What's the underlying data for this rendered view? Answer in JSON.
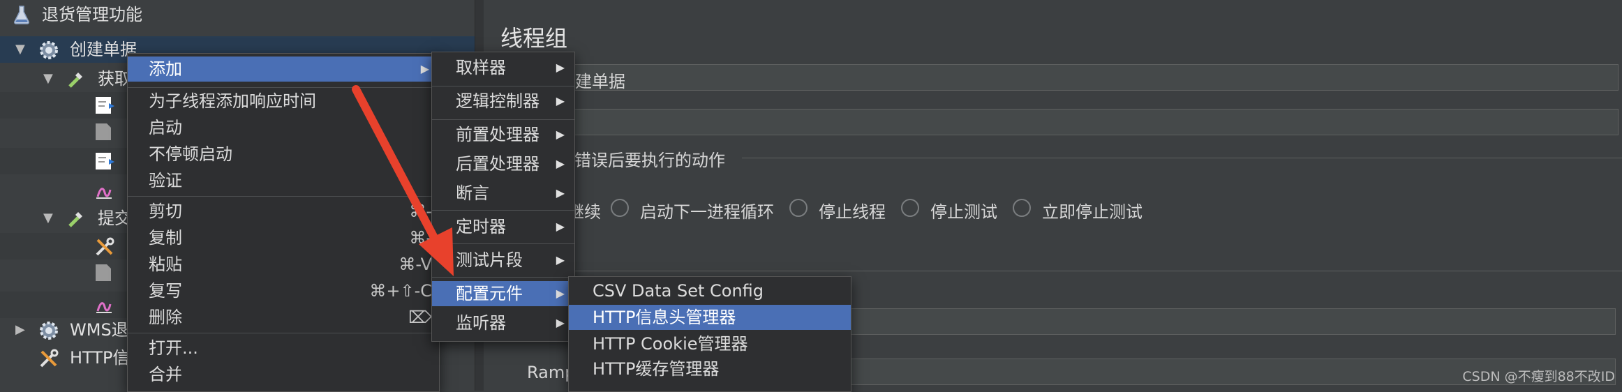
{
  "tree": {
    "root_label": "退货管理功能",
    "items": [
      {
        "label": "创建单据"
      },
      {
        "label": "获取"
      },
      {
        "label": "提交"
      },
      {
        "label": "WMS退"
      },
      {
        "label": "HTTP信"
      }
    ]
  },
  "panel": {
    "title": "线程组",
    "name_value": "创建单据",
    "error_action_label": "错误后要执行的动作",
    "radio_options": [
      "继续",
      "启动下一进程循环",
      "停止线程",
      "停止测试",
      "立即停止测试"
    ],
    "ramp_label": "Ramp"
  },
  "context_menu": {
    "items": [
      {
        "label": "添加",
        "shortcut": "",
        "submenu": true
      },
      {
        "label": "为子线程添加响应时间",
        "shortcut": ""
      },
      {
        "label": "启动",
        "shortcut": ""
      },
      {
        "label": "不停顿启动",
        "shortcut": ""
      },
      {
        "label": "验证",
        "shortcut": ""
      },
      {
        "label": "剪切",
        "shortcut": "⌘-"
      },
      {
        "label": "复制",
        "shortcut": "⌘-"
      },
      {
        "label": "粘贴",
        "shortcut": "⌘-V"
      },
      {
        "label": "复写",
        "shortcut": "⌘+⇧-C"
      },
      {
        "label": "删除",
        "shortcut": "⌦"
      },
      {
        "label": "打开...",
        "shortcut": ""
      },
      {
        "label": "合并",
        "shortcut": ""
      }
    ]
  },
  "add_submenu": {
    "items": [
      "取样器",
      "逻辑控制器",
      "前置处理器",
      "后置处理器",
      "断言",
      "定时器",
      "测试片段",
      "配置元件",
      "监听器"
    ]
  },
  "config_submenu": {
    "items": [
      "CSV Data Set Config",
      "HTTP信息头管理器",
      "HTTP Cookie管理器",
      "HTTP缓存管理器"
    ]
  },
  "watermark": "CSDN @不瘦到88不改ID",
  "colors": {
    "highlight": "#4a6fb5",
    "background": "#3c3f41",
    "arrow": "#e8412c"
  }
}
